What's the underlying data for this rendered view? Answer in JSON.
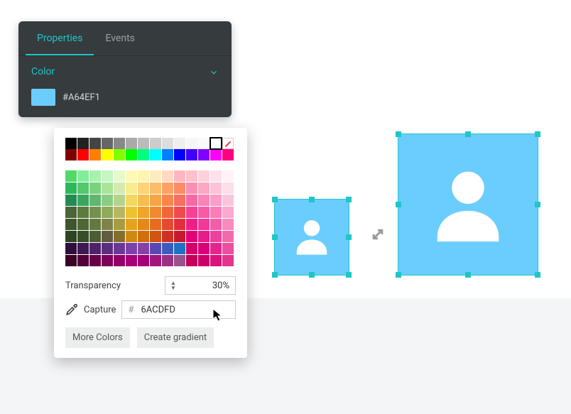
{
  "panel": {
    "tabs": {
      "properties": "Properties",
      "events": "Events"
    },
    "section": {
      "title": "Color",
      "hex": "#A64EF1"
    }
  },
  "picker": {
    "basic_rows": [
      [
        "#000000",
        "#222222",
        "#444444",
        "#666666",
        "#888888",
        "#aaaaaa",
        "#bbbbbb",
        "#cccccc",
        "#dddddd",
        "#eeeeee",
        "#f6f6f6",
        "#fafafa",
        "#ffffff",
        "none"
      ],
      [
        "#800000",
        "#ff0000",
        "#ff8000",
        "#ffff00",
        "#80ff00",
        "#00ff00",
        "#00ff80",
        "#00ffff",
        "#0080ff",
        "#0000ff",
        "#4000ff",
        "#8000ff",
        "#ff00ff",
        "#ff0080"
      ]
    ],
    "extended_rows": [
      [
        "#53d86a",
        "#80ed99",
        "#a7f3aa",
        "#c4f7c1",
        "#e5fbcd",
        "#fff9b8",
        "#fff4b0",
        "#ffecc0",
        "#ffd9c0",
        "#ffb6c1",
        "#ffc0cb",
        "#ffd1dc",
        "#ffe0eb",
        "#fff2f8"
      ],
      [
        "#2eb85c",
        "#54c76f",
        "#7ad27d",
        "#a8e59a",
        "#d4eab0",
        "#f9eb8e",
        "#fbd379",
        "#fcbc68",
        "#fca267",
        "#fb8c66",
        "#fb8eb5",
        "#fca7c4",
        "#fcc2d6",
        "#fddee9"
      ],
      [
        "#228b53",
        "#3ba55d",
        "#5fb770",
        "#8acc83",
        "#b2d48f",
        "#f4d760",
        "#f6be4f",
        "#f7a445",
        "#f7864b",
        "#f66f5f",
        "#f868a7",
        "#fa83b8",
        "#fa9ec9",
        "#fbc4de"
      ],
      [
        "#4b6538",
        "#5d7a3f",
        "#74904c",
        "#8faa58",
        "#b8b662",
        "#eec032",
        "#f0a528",
        "#f2882f",
        "#f1653b",
        "#ef4a4d",
        "#f34196",
        "#f65ba6",
        "#f97db6",
        "#fba9cf"
      ],
      [
        "#3f552e",
        "#4e6733",
        "#62793d",
        "#7f834b",
        "#a59d3e",
        "#e5a21f",
        "#e6871a",
        "#e76c22",
        "#e54a2f",
        "#e2303a",
        "#ed1e87",
        "#f13997",
        "#f45da9",
        "#f88abe"
      ],
      [
        "#2c4522",
        "#384e29",
        "#4c5c34",
        "#615b3f",
        "#836f2b",
        "#cf8912",
        "#d06e0c",
        "#d15413",
        "#cf3123",
        "#c8192c",
        "#e30078",
        "#e71c89",
        "#ec419c",
        "#f26aae"
      ],
      [
        "#2f0e3e",
        "#3f1854",
        "#4e2269",
        "#5c2c7f",
        "#6b3794",
        "#7a41a9",
        "#8441a6",
        "#5748b6",
        "#3d5bbe",
        "#1e72c4",
        "#d20068",
        "#da007a",
        "#e3258c",
        "#eb4f9d"
      ],
      [
        "#3b002a",
        "#52003a",
        "#68004a",
        "#7e005a",
        "#930069",
        "#a90079",
        "#a50277",
        "#a11679",
        "#9c3083",
        "#98528c",
        "#c40059",
        "#cd006a",
        "#d9127c",
        "#e5348e"
      ]
    ],
    "transparency": {
      "label": "Transparency",
      "value": "30%"
    },
    "capture": {
      "label": "Capture",
      "hash": "#",
      "hex": "6ACDFD"
    },
    "buttons": {
      "more": "More Colors",
      "gradient": "Create gradient"
    }
  }
}
